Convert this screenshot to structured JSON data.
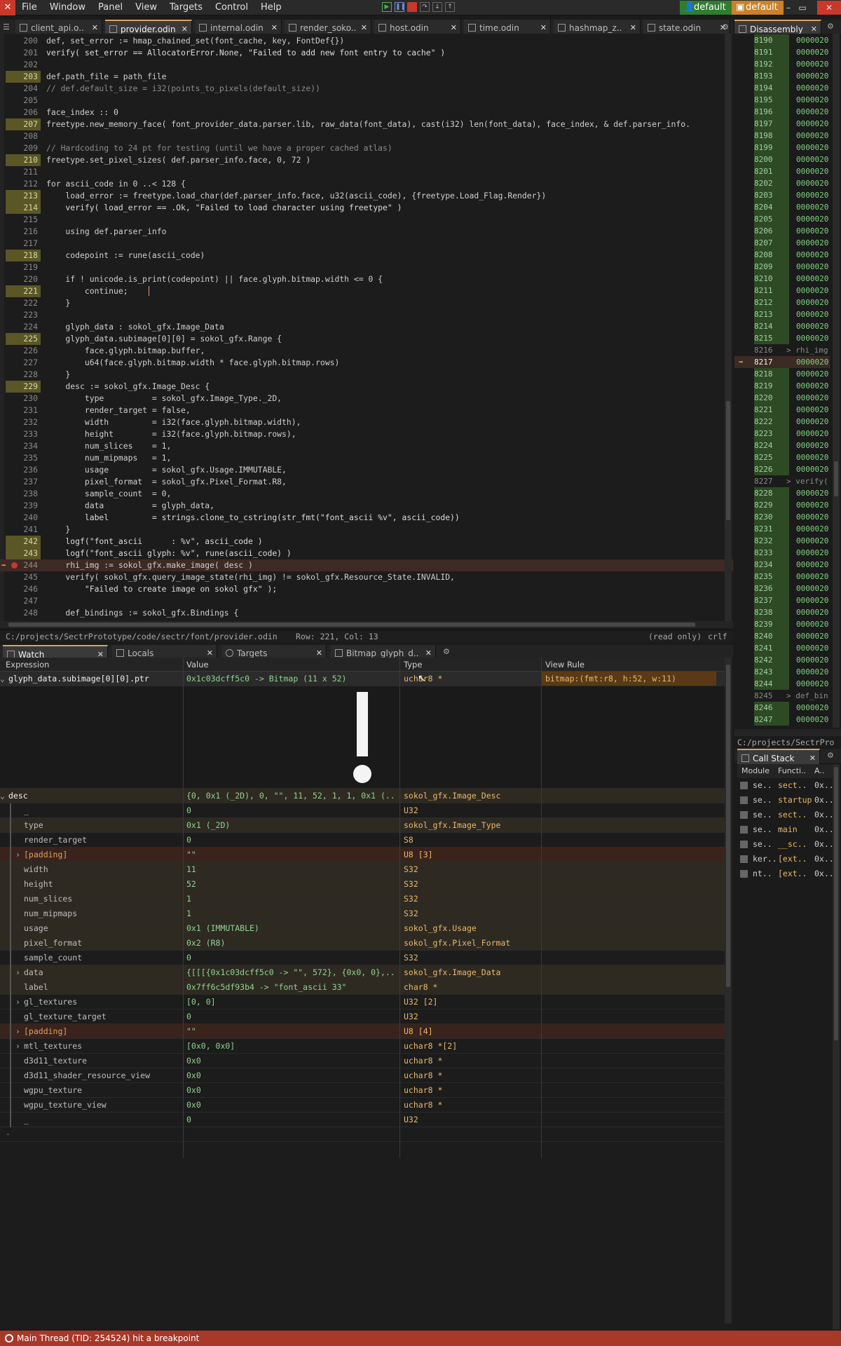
{
  "menu": [
    "File",
    "Window",
    "Panel",
    "View",
    "Targets",
    "Control",
    "Help"
  ],
  "user_buttons": [
    "default",
    "default"
  ],
  "editor_tabs": [
    {
      "label": "client_api.o..",
      "active": false
    },
    {
      "label": "provider.odin",
      "active": true
    },
    {
      "label": "internal.odin",
      "active": false
    },
    {
      "label": "render_soko..",
      "active": false
    },
    {
      "label": "host.odin",
      "active": false
    },
    {
      "label": "time.odin",
      "active": false
    },
    {
      "label": "hashmap_z..",
      "active": false
    },
    {
      "label": "state.odin",
      "active": false
    }
  ],
  "code_lines": [
    {
      "n": "200",
      "t": "def, set_error := hmap_chained_set(font_cache, key, FontDef{})",
      "hl": false
    },
    {
      "n": "201",
      "t": "verify( set_error == AllocatorError.None, \"Failed to add new font entry to cache\" )",
      "hl": false
    },
    {
      "n": "202",
      "t": "",
      "hl": false
    },
    {
      "n": "203",
      "t": "def.path_file = path_file",
      "hl": true
    },
    {
      "n": "204",
      "t": "// def.default_size = i32(points_to_pixels(default_size))",
      "hl": false,
      "cm": true
    },
    {
      "n": "205",
      "t": "",
      "hl": false
    },
    {
      "n": "206",
      "t": "face_index :: 0",
      "hl": false
    },
    {
      "n": "207",
      "t": "freetype.new_memory_face( font_provider_data.parser.lib, raw_data(font_data), cast(i32) len(font_data), face_index, & def.parser_info.",
      "hl": true
    },
    {
      "n": "208",
      "t": "",
      "hl": false
    },
    {
      "n": "209",
      "t": "// Hardcoding to 24 pt for testing (until we have a proper cached atlas)",
      "hl": false,
      "cm": true
    },
    {
      "n": "210",
      "t": "freetype.set_pixel_sizes( def.parser_info.face, 0, 72 )",
      "hl": true
    },
    {
      "n": "211",
      "t": "",
      "hl": false
    },
    {
      "n": "212",
      "t": "for ascii_code in 0 ..< 128 {",
      "hl": false
    },
    {
      "n": "213",
      "t": "    load_error := freetype.load_char(def.parser_info.face, u32(ascii_code), {freetype.Load_Flag.Render})",
      "hl": true
    },
    {
      "n": "214",
      "t": "    verify( load_error == .Ok, \"Failed to load character using freetype\" )",
      "hl": true
    },
    {
      "n": "215",
      "t": "",
      "hl": false
    },
    {
      "n": "216",
      "t": "    using def.parser_info",
      "hl": false
    },
    {
      "n": "217",
      "t": "",
      "hl": false
    },
    {
      "n": "218",
      "t": "    codepoint := rune(ascii_code)",
      "hl": true
    },
    {
      "n": "219",
      "t": "",
      "hl": false
    },
    {
      "n": "220",
      "t": "    if ! unicode.is_print(codepoint) || face.glyph.bitmap.width <= 0 {",
      "hl": false
    },
    {
      "n": "221",
      "t": "        continue;",
      "hl": true
    },
    {
      "n": "222",
      "t": "    }",
      "hl": false
    },
    {
      "n": "223",
      "t": "",
      "hl": false
    },
    {
      "n": "224",
      "t": "    glyph_data : sokol_gfx.Image_Data",
      "hl": false
    },
    {
      "n": "225",
      "t": "    glyph_data.subimage[0][0] = sokol_gfx.Range {",
      "hl": true
    },
    {
      "n": "226",
      "t": "        face.glyph.bitmap.buffer,",
      "hl": false
    },
    {
      "n": "227",
      "t": "        u64(face.glyph.bitmap.width * face.glyph.bitmap.rows)",
      "hl": false
    },
    {
      "n": "228",
      "t": "    }",
      "hl": false
    },
    {
      "n": "229",
      "t": "    desc := sokol_gfx.Image_Desc {",
      "hl": true
    },
    {
      "n": "230",
      "t": "        type          = sokol_gfx.Image_Type._2D,",
      "hl": false
    },
    {
      "n": "231",
      "t": "        render_target = false,",
      "hl": false
    },
    {
      "n": "232",
      "t": "        width         = i32(face.glyph.bitmap.width),",
      "hl": false
    },
    {
      "n": "233",
      "t": "        height        = i32(face.glyph.bitmap.rows),",
      "hl": false
    },
    {
      "n": "234",
      "t": "        num_slices    = 1,",
      "hl": false
    },
    {
      "n": "235",
      "t": "        num_mipmaps   = 1,",
      "hl": false
    },
    {
      "n": "236",
      "t": "        usage         = sokol_gfx.Usage.IMMUTABLE,",
      "hl": false
    },
    {
      "n": "237",
      "t": "        pixel_format  = sokol_gfx.Pixel_Format.R8,",
      "hl": false
    },
    {
      "n": "238",
      "t": "        sample_count  = 0,",
      "hl": false
    },
    {
      "n": "239",
      "t": "        data          = glyph_data,",
      "hl": false
    },
    {
      "n": "240",
      "t": "        label         = strings.clone_to_cstring(str_fmt(\"font_ascii %v\", ascii_code))",
      "hl": false
    },
    {
      "n": "241",
      "t": "    }",
      "hl": false
    },
    {
      "n": "242",
      "t": "    logf(\"font_ascii      : %v\", ascii_code )",
      "hl": true
    },
    {
      "n": "243",
      "t": "    logf(\"font_ascii glyph: %v\", rune(ascii_code) )",
      "hl": true
    },
    {
      "n": "244",
      "t": "    rhi_img := sokol_gfx.make_image( desc )",
      "hl": false,
      "bp": true
    },
    {
      "n": "245",
      "t": "    verify( sokol_gfx.query_image_state(rhi_img) != sokol_gfx.Resource_State.INVALID,",
      "hl": false
    },
    {
      "n": "246",
      "t": "        \"Failed to create image on sokol gfx\" );",
      "hl": false
    },
    {
      "n": "247",
      "t": "",
      "hl": false
    },
    {
      "n": "248",
      "t": "    def_bindings := sokol_gfx.Bindings {",
      "hl": false
    }
  ],
  "code_status": {
    "path": "C:/projects/SectrPrototype/code/sectr/font/provider.odin",
    "pos": "Row: 221, Col: 13",
    "mode": "(read only)",
    "eol": "crlf"
  },
  "watch_tabs": [
    "Watch",
    "Locals",
    "Targets",
    "Bitmap_glyph_d.."
  ],
  "watch_headers": [
    "Expression",
    "Value",
    "Type",
    "View Rule"
  ],
  "watch_rows": [
    {
      "expr": "glyph_data.subimage[0][0].ptr",
      "val": "0x1c03dcff5c0 -> Bitmap (11 x 52)",
      "type": "uchar8 *",
      "rule": "bitmap:(fmt:r8, h:52, w:11)",
      "style": "top",
      "arrow": "v"
    },
    {
      "expr": "desc",
      "val": "{0, 0x1 (_2D), 0, \"\", 11, 52, 1, 1, 0x1 (...",
      "type": "sokol_gfx.Image_Desc",
      "rule": "",
      "style": "alt",
      "arrow": "v"
    },
    {
      "expr": "_",
      "val": "0",
      "type": "U32",
      "rule": "",
      "style": "",
      "arrow": ""
    },
    {
      "expr": "type",
      "val": "0x1 (_2D)",
      "type": "sokol_gfx.Image_Type",
      "rule": "",
      "style": "alt",
      "arrow": ""
    },
    {
      "expr": "render_target",
      "val": "0",
      "type": "S8",
      "rule": "",
      "style": "",
      "arrow": ""
    },
    {
      "expr": "[padding]",
      "val": "\"\"",
      "type": "U8 [3]",
      "rule": "",
      "style": "red",
      "arrow": ">"
    },
    {
      "expr": "width",
      "val": "11",
      "type": "S32",
      "rule": "",
      "style": "alt",
      "arrow": ""
    },
    {
      "expr": "height",
      "val": "52",
      "type": "S32",
      "rule": "",
      "style": "alt",
      "arrow": ""
    },
    {
      "expr": "num_slices",
      "val": "1",
      "type": "S32",
      "rule": "",
      "style": "alt",
      "arrow": ""
    },
    {
      "expr": "num_mipmaps",
      "val": "1",
      "type": "S32",
      "rule": "",
      "style": "alt",
      "arrow": ""
    },
    {
      "expr": "usage",
      "val": "0x1 (IMMUTABLE)",
      "type": "sokol_gfx.Usage",
      "rule": "",
      "style": "alt",
      "arrow": ""
    },
    {
      "expr": "pixel_format",
      "val": "0x2 (R8)",
      "type": "sokol_gfx.Pixel_Format",
      "rule": "",
      "style": "alt",
      "arrow": ""
    },
    {
      "expr": "sample_count",
      "val": "0",
      "type": "S32",
      "rule": "",
      "style": "",
      "arrow": ""
    },
    {
      "expr": "data",
      "val": "{[[[{0x1c03dcff5c0 -> \"\", 572}, {0x0, 0},...",
      "type": "sokol_gfx.Image_Data",
      "rule": "",
      "style": "alt",
      "arrow": ">"
    },
    {
      "expr": "label",
      "val": "0x7ff6c5df93b4 -> \"font_ascii 33\"",
      "type": "char8 *",
      "rule": "",
      "style": "alt",
      "arrow": ""
    },
    {
      "expr": "gl_textures",
      "val": "[0, 0]",
      "type": "U32 [2]",
      "rule": "",
      "style": "",
      "arrow": ">"
    },
    {
      "expr": "gl_texture_target",
      "val": "0",
      "type": "U32",
      "rule": "",
      "style": "",
      "arrow": ""
    },
    {
      "expr": "[padding]",
      "val": "\"\"",
      "type": "U8 [4]",
      "rule": "",
      "style": "red",
      "arrow": ">"
    },
    {
      "expr": "mtl_textures",
      "val": "[0x0, 0x0]",
      "type": "uchar8 *[2]",
      "rule": "",
      "style": "",
      "arrow": ">"
    },
    {
      "expr": "d3d11_texture",
      "val": "0x0",
      "type": "uchar8 *",
      "rule": "",
      "style": "",
      "arrow": ""
    },
    {
      "expr": "d3d11_shader_resource_view",
      "val": "0x0",
      "type": "uchar8 *",
      "rule": "",
      "style": "",
      "arrow": ""
    },
    {
      "expr": "wgpu_texture",
      "val": "0x0",
      "type": "uchar8 *",
      "rule": "",
      "style": "",
      "arrow": ""
    },
    {
      "expr": "wgpu_texture_view",
      "val": "0x0",
      "type": "uchar8 *",
      "rule": "",
      "style": "",
      "arrow": ""
    },
    {
      "expr": "_",
      "val": "0",
      "type": "U32",
      "rule": "",
      "style": "",
      "arrow": ""
    }
  ],
  "disassembly": {
    "title": "Disassembly",
    "rows": [
      {
        "n": "8190",
        "v": "0000020"
      },
      {
        "n": "8191",
        "v": "0000020"
      },
      {
        "n": "8192",
        "v": "0000020"
      },
      {
        "n": "8193",
        "v": "0000020"
      },
      {
        "n": "8194",
        "v": "0000020"
      },
      {
        "n": "8195",
        "v": "0000020"
      },
      {
        "n": "8196",
        "v": "0000020"
      },
      {
        "n": "8197",
        "v": "0000020"
      },
      {
        "n": "8198",
        "v": "0000020"
      },
      {
        "n": "8199",
        "v": "0000020"
      },
      {
        "n": "8200",
        "v": "0000020"
      },
      {
        "n": "8201",
        "v": "0000020"
      },
      {
        "n": "8202",
        "v": "0000020"
      },
      {
        "n": "8203",
        "v": "0000020"
      },
      {
        "n": "8204",
        "v": "0000020"
      },
      {
        "n": "8205",
        "v": "0000020"
      },
      {
        "n": "8206",
        "v": "0000020"
      },
      {
        "n": "8207",
        "v": "0000020"
      },
      {
        "n": "8208",
        "v": "0000020"
      },
      {
        "n": "8209",
        "v": "0000020"
      },
      {
        "n": "8210",
        "v": "0000020"
      },
      {
        "n": "8211",
        "v": "0000020"
      },
      {
        "n": "8212",
        "v": "0000020"
      },
      {
        "n": "8213",
        "v": "0000020"
      },
      {
        "n": "8214",
        "v": "0000020"
      },
      {
        "n": "8215",
        "v": "0000020"
      },
      {
        "n": "8216",
        "v": "> rhi_img",
        "src": true
      },
      {
        "n": "8217",
        "v": "0000020",
        "cur": true
      },
      {
        "n": "8218",
        "v": "0000020"
      },
      {
        "n": "8219",
        "v": "0000020"
      },
      {
        "n": "8220",
        "v": "0000020"
      },
      {
        "n": "8221",
        "v": "0000020"
      },
      {
        "n": "8222",
        "v": "0000020"
      },
      {
        "n": "8223",
        "v": "0000020"
      },
      {
        "n": "8224",
        "v": "0000020"
      },
      {
        "n": "8225",
        "v": "0000020"
      },
      {
        "n": "8226",
        "v": "0000020"
      },
      {
        "n": "8227",
        "v": "> verify(",
        "src": true
      },
      {
        "n": "8228",
        "v": "0000020"
      },
      {
        "n": "8229",
        "v": "0000020"
      },
      {
        "n": "8230",
        "v": "0000020"
      },
      {
        "n": "8231",
        "v": "0000020"
      },
      {
        "n": "8232",
        "v": "0000020"
      },
      {
        "n": "8233",
        "v": "0000020"
      },
      {
        "n": "8234",
        "v": "0000020"
      },
      {
        "n": "8235",
        "v": "0000020"
      },
      {
        "n": "8236",
        "v": "0000020"
      },
      {
        "n": "8237",
        "v": "0000020"
      },
      {
        "n": "8238",
        "v": "0000020"
      },
      {
        "n": "8239",
        "v": "0000020"
      },
      {
        "n": "8240",
        "v": "0000020"
      },
      {
        "n": "8241",
        "v": "0000020"
      },
      {
        "n": "8242",
        "v": "0000020"
      },
      {
        "n": "8243",
        "v": "0000020"
      },
      {
        "n": "8244",
        "v": "0000020"
      },
      {
        "n": "8245",
        "v": "> def_bin",
        "src": true
      },
      {
        "n": "8246",
        "v": "0000020"
      },
      {
        "n": "8247",
        "v": "0000020"
      }
    ],
    "path": "C:/projects/SectrPro"
  },
  "callstack": {
    "title": "Call Stack",
    "headers": [
      "Module",
      "Functi..",
      "A.."
    ],
    "rows": [
      {
        "m": "se..",
        "f": "sect..",
        "a": "0x.."
      },
      {
        "m": "se..",
        "f": "startup",
        "a": "0x.."
      },
      {
        "m": "se..",
        "f": "sect..",
        "a": "0x.."
      },
      {
        "m": "se..",
        "f": "main",
        "a": "0x.."
      },
      {
        "m": "se..",
        "f": "__sc..",
        "a": "0x.."
      },
      {
        "m": "ker..",
        "f": "[ext..",
        "a": "0x.."
      },
      {
        "m": "nt..",
        "f": "[ext..",
        "a": "0x.."
      }
    ]
  },
  "status": "Main Thread (TID: 254524) hit a breakpoint",
  "colors": {
    "accent": "#d9a35f",
    "status_bg": "#a83828",
    "user_btn_green": "#2f7d2f",
    "user_btn_orange": "#c9822a"
  }
}
